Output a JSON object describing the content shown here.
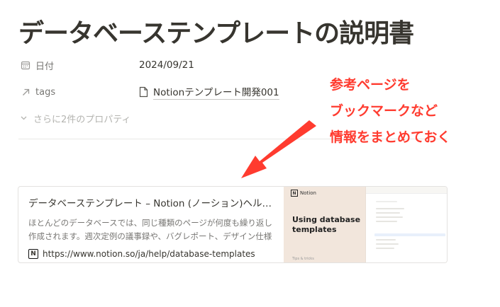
{
  "page": {
    "title": "データベーステンプレートの説明書"
  },
  "properties": [
    {
      "icon": "calendar-icon",
      "name": "日付",
      "value": "2024/09/21"
    },
    {
      "icon": "relation-arrow-icon",
      "name": "tags",
      "value": "Notionテンプレート開発001"
    }
  ],
  "more_properties": {
    "label": "さらに2件のプロパティ"
  },
  "callout": {
    "lines": [
      "参考ページを",
      "ブックマークなど",
      "情報をまとめておく"
    ],
    "color": "#ff3b2f"
  },
  "bookmark": {
    "title": "データベーステンプレート – Notion (ノーション)ヘルプ…",
    "description": "ほとんどのデータベースでは、同じ種類のページが何度も繰り返し作成されます。週次定例の議事録や、バグレポート、デザイン仕様書な",
    "url": "https://www.notion.so/ja/help/database-templates",
    "thumbnail": {
      "brand": "Notion",
      "heading": "Using database templates",
      "footer": "Tips & tricks"
    }
  },
  "colors": {
    "text": "#37352f",
    "muted": "#787774",
    "accent": "#ff3b2f",
    "thumbnail_bg": "#f2e6dc"
  }
}
